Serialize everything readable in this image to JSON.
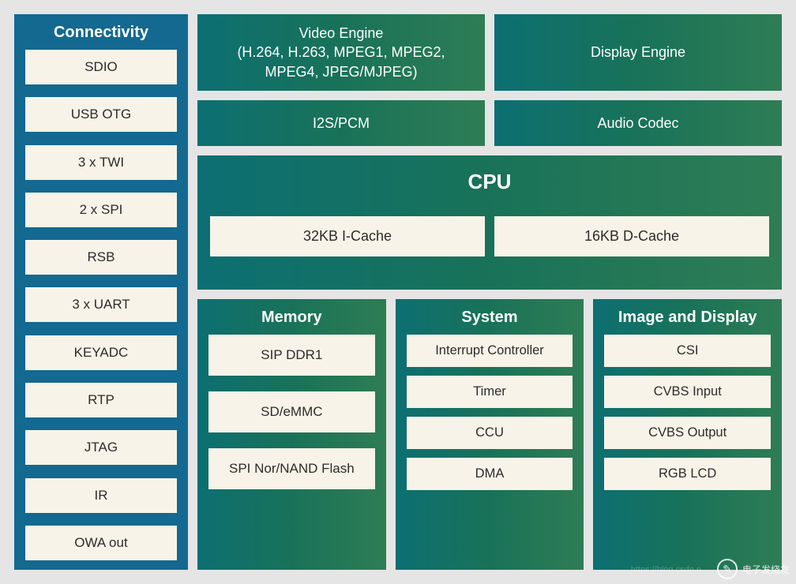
{
  "connectivity": {
    "title": "Connectivity",
    "items": [
      "SDIO",
      "USB OTG",
      "3 x TWI",
      "2 x SPI",
      "RSB",
      "3 x UART",
      "KEYADC",
      "RTP",
      "JTAG",
      "IR",
      "OWA out"
    ]
  },
  "video_engine": {
    "title": "Video Engine",
    "subtitle": "(H.264, H.263, MPEG1, MPEG2, MPEG4, JPEG/MJPEG)"
  },
  "display_engine": "Display Engine",
  "i2s_pcm": "I2S/PCM",
  "audio_codec": "Audio Codec",
  "cpu": {
    "title": "CPU",
    "icache": "32KB I-Cache",
    "dcache": "16KB D-Cache"
  },
  "memory": {
    "title": "Memory",
    "items": [
      "SIP DDR1",
      "SD/eMMC",
      "SPI Nor/NAND Flash"
    ]
  },
  "system": {
    "title": "System",
    "items": [
      "Interrupt Controller",
      "Timer",
      "CCU",
      "DMA"
    ]
  },
  "image_display": {
    "title": "Image and Display",
    "items": [
      "CSI",
      "CVBS Input",
      "CVBS Output",
      "RGB LCD"
    ]
  },
  "watermark": {
    "brand": "电子发烧友",
    "url_faint": "https://blog.csdn.n"
  }
}
